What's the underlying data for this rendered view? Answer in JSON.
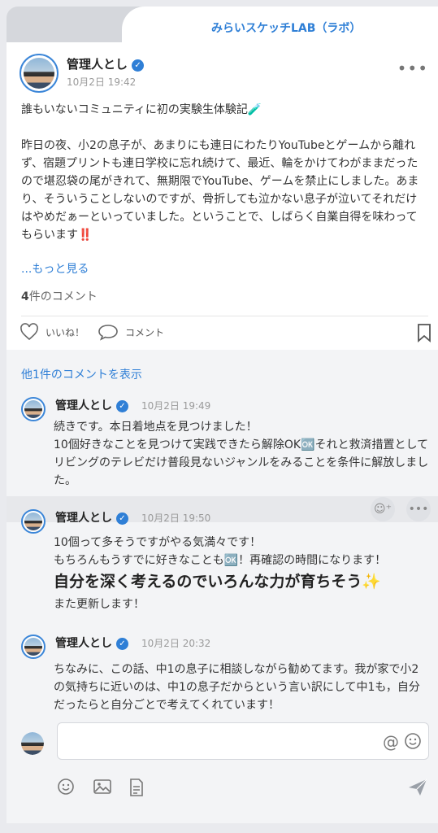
{
  "community_tab": "みらいスケッチLAB（ラボ）",
  "post": {
    "author": "管理人とし",
    "date": "10月2日 19:42",
    "text": "誰もいないコミュニティに初の実験生体験記🧪\n\n昨日の夜、小2の息子が、あまりにも連日にわたりYouTubeとゲームから離れず、宿題プリントも連日学校に忘れ続けて、最近、輪をかけてわがままだったので堪忍袋の尾がきれて、無期限でYouTube、ゲームを禁止にしました。あまり、そういうことしないのですが、骨折しても泣かない息子が泣いてそれだけはやめだぁーといっていました。ということで、しばらく自業自得を味わってもらいます‼️",
    "see_more": "...もっと見る",
    "comment_count_number": "4",
    "comment_count_suffix": "件のコメント",
    "like_label": "いいね！",
    "comment_label": "コメント"
  },
  "comments": {
    "show_more": "他1件のコメントを表示",
    "items": [
      {
        "author": "管理人とし",
        "date": "10月2日 19:49",
        "text": "続きです。本日着地点を見つけました！\n10個好きなことを見つけて実践できたら解除OK🆗それと救済措置としてリビングのテレビだけ普段見ないジャンルをみることを条件に解放しました。"
      },
      {
        "author": "管理人とし",
        "date": "10月2日 19:50",
        "text_1": "10個って多そうですがやる気満々です！\nもちろんもうすでに好きなことも🆗！再確認の時間になります！",
        "emphasis": "自分を深く考えるのでいろんな力が育ちそう✨",
        "text_2": "また更新します！"
      },
      {
        "author": "管理人とし",
        "date": "10月2日 20:32",
        "text": "ちなみに、この話、中1の息子に相談しながら勧めてます。我が家で小2の気持ちに近いのは、中1の息子だからという言い訳にして中1も，自分だったらと自分ごとで考えてくれています！"
      }
    ]
  },
  "composer": {
    "placeholder": "",
    "at_symbol": "@"
  },
  "colors": {
    "accent": "#2f7fd6",
    "comments_bg": "#f3f4f6"
  },
  "icons": [
    "heart-icon",
    "comment-bubble-icon",
    "bookmark-icon",
    "more-dots-icon",
    "verified-badge-icon",
    "add-reaction-icon",
    "emoji-icon",
    "image-icon",
    "document-icon",
    "send-icon"
  ]
}
